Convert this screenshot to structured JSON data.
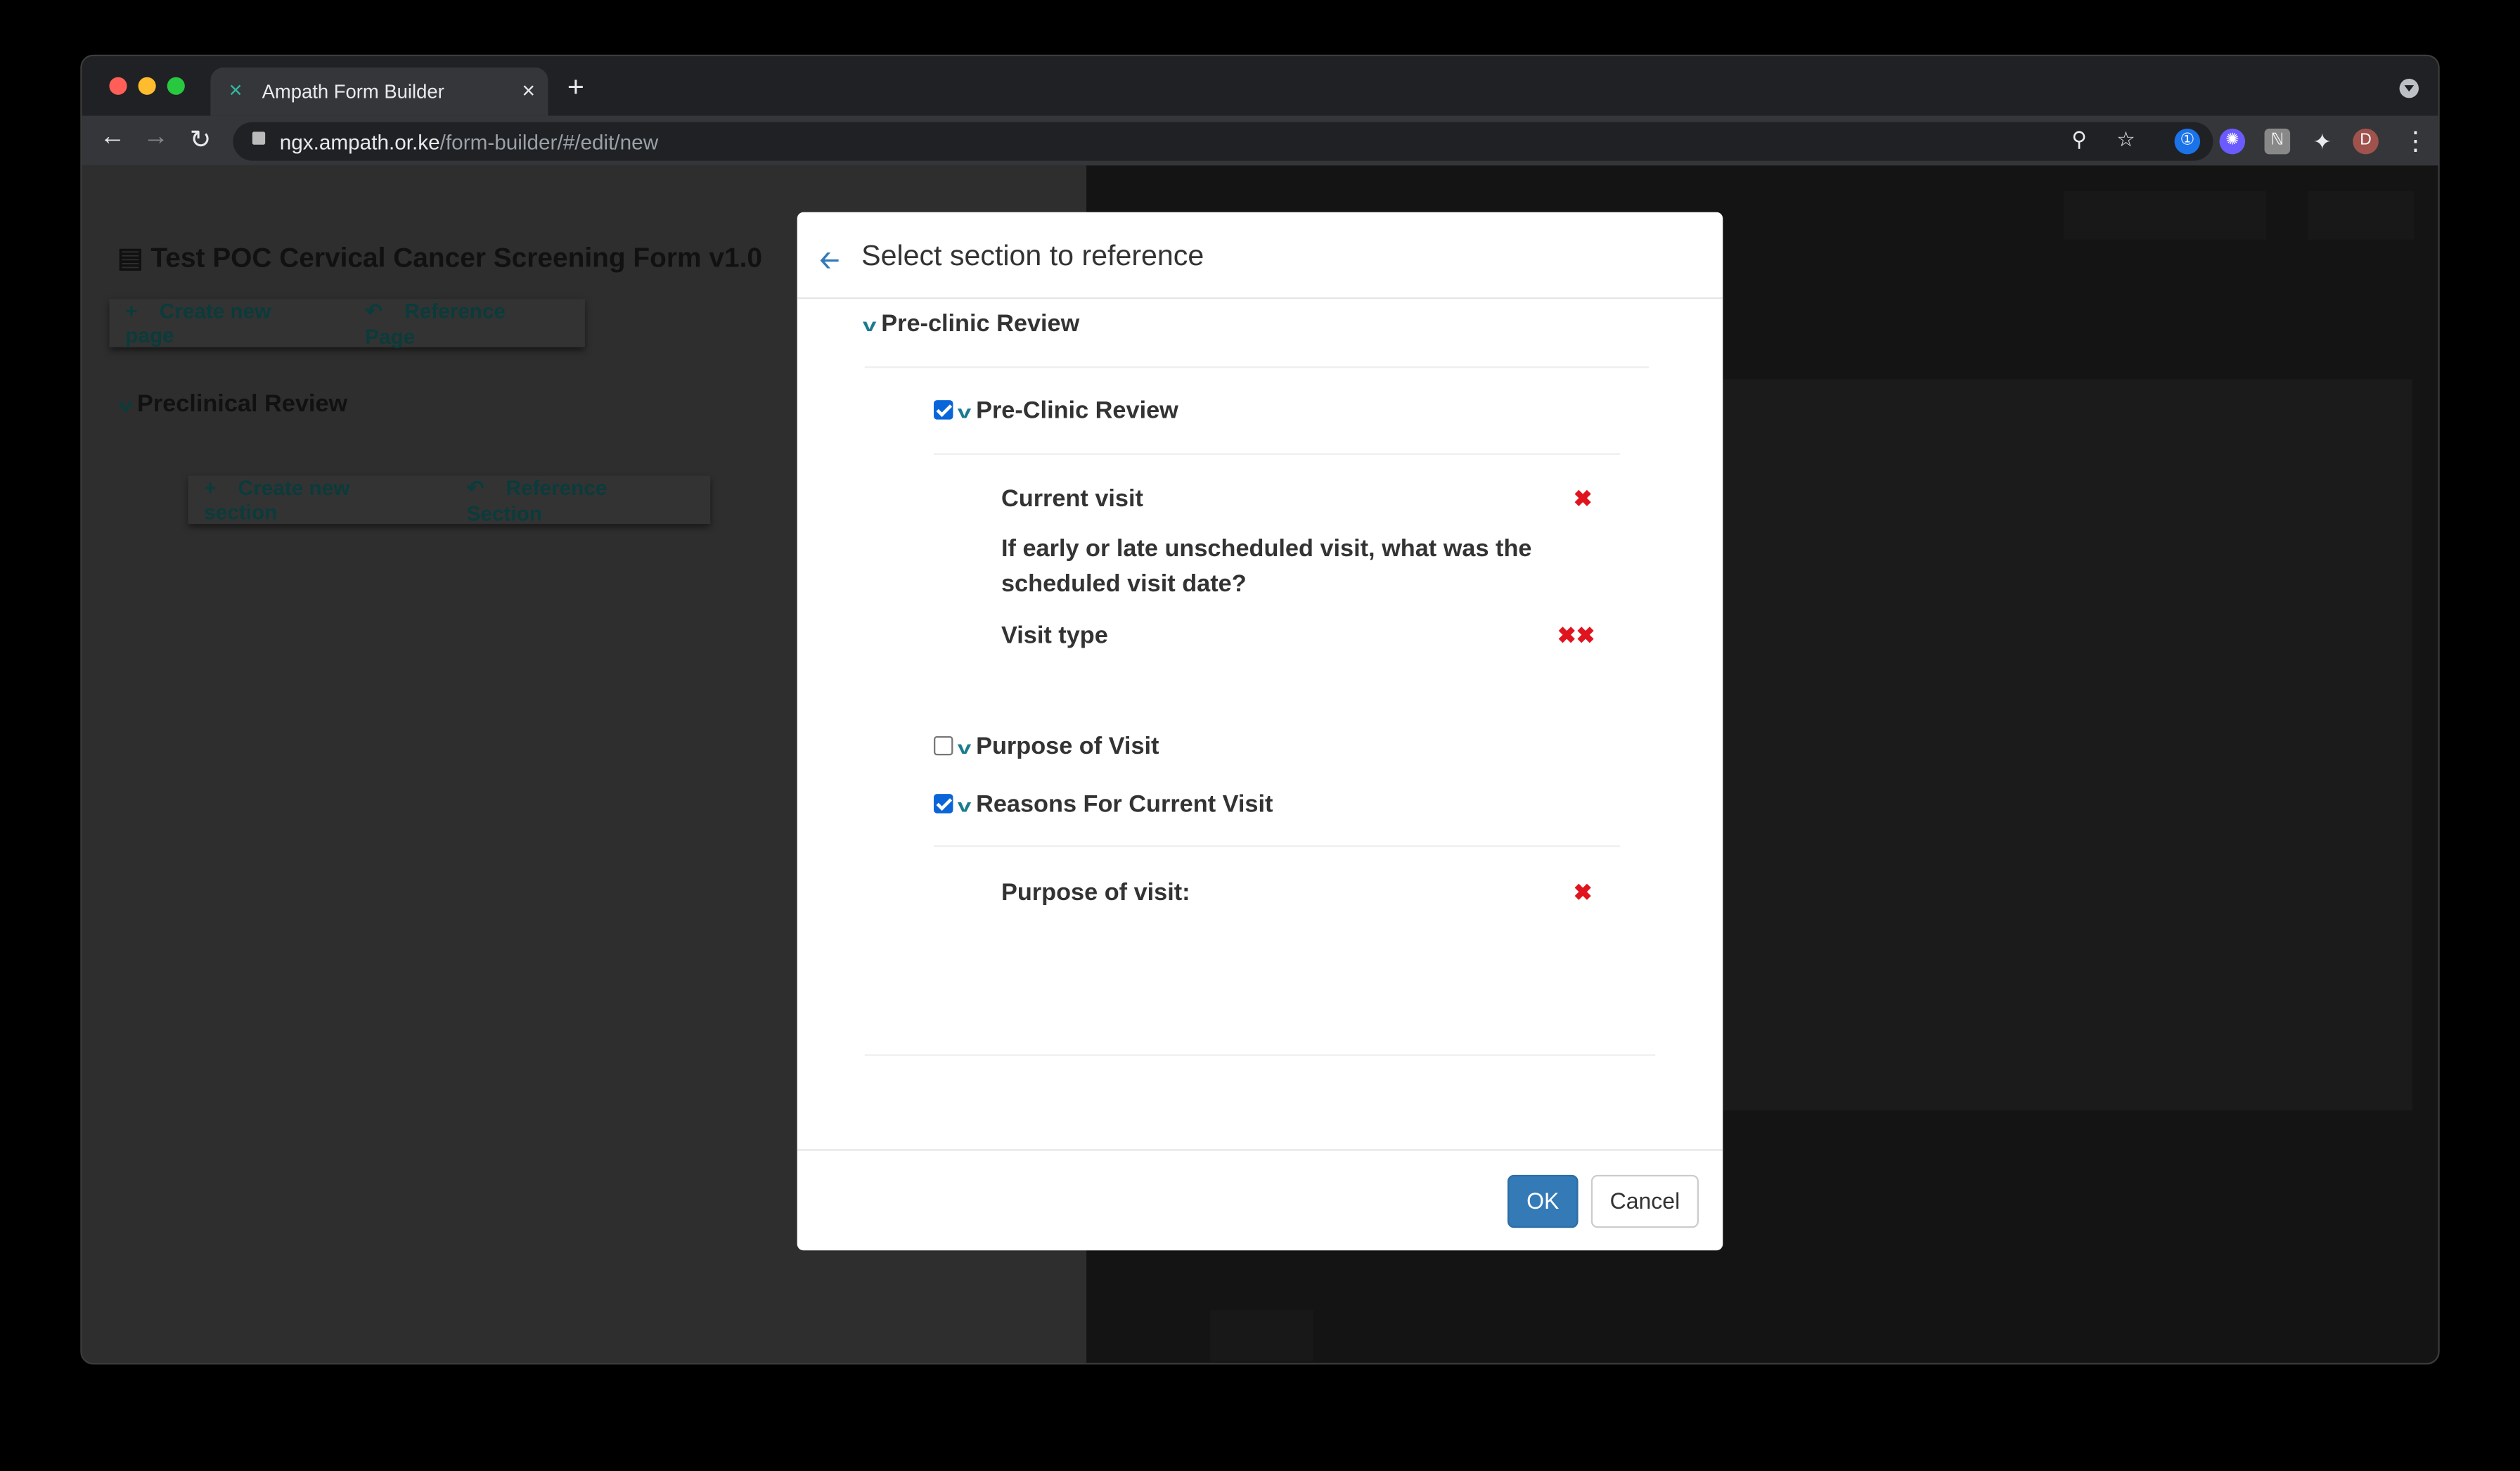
{
  "browser": {
    "tab_title": "Ampath Form Builder",
    "url_host": "ngx.ampath.or.ke",
    "url_path": "/form-builder/#/edit/new",
    "avatar_letter": "D",
    "icons": [
      "back-arrow-icon",
      "forward-arrow-icon",
      "reload-icon",
      "lock-icon",
      "zoom-icon",
      "star-icon",
      "puzzle-icon",
      "more-icon"
    ]
  },
  "background": {
    "form_title": "Test POC Cervical Cancer Screening Form v1.0",
    "create_page": "Create new page",
    "reference_page": "Reference Page",
    "page_heading": "Preclinical Review",
    "create_section": "Create new section",
    "reference_section": "Reference Section"
  },
  "modal": {
    "title": "Select section to reference",
    "page_name": "Pre-clinic Review",
    "sections": [
      {
        "name": "Pre-Clinic Review",
        "checked": true,
        "questions": [
          {
            "label": "Current visit",
            "marks": "✖"
          },
          {
            "label": "If early or late unscheduled visit, what was the scheduled visit date?",
            "marks": ""
          },
          {
            "label": "Visit type",
            "marks": "✖✖"
          }
        ]
      },
      {
        "name": "Purpose of Visit",
        "checked": false,
        "questions": []
      },
      {
        "name": "Reasons For Current Visit",
        "checked": true,
        "questions": [
          {
            "label": "Purpose of visit:",
            "marks": "✖"
          }
        ]
      }
    ],
    "ok_label": "OK",
    "cancel_label": "Cancel"
  },
  "colors": {
    "primary": "#337ab7",
    "chevron": "#1b7c8f",
    "remove": "#e0141e"
  }
}
